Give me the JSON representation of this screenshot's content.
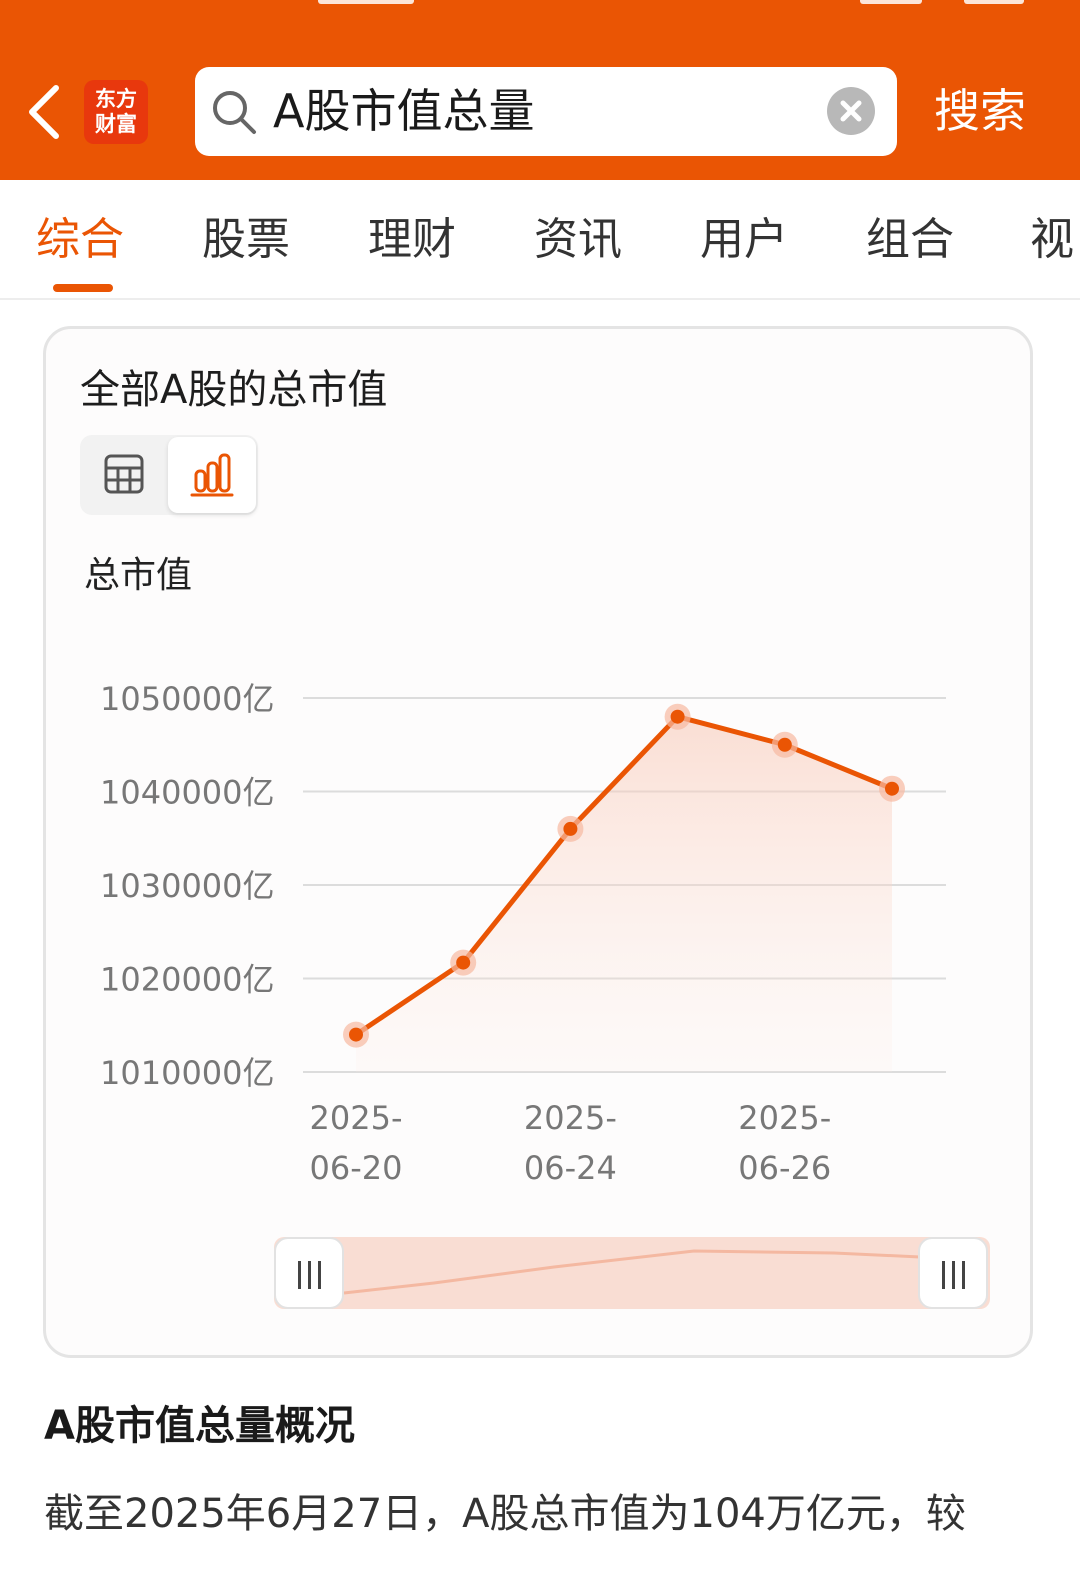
{
  "header": {
    "logo_line1": "东方",
    "logo_line2": "财富",
    "search_query": "A股市值总量",
    "search_button": "搜索",
    "accent_color": "#ea5504"
  },
  "tabs": [
    {
      "label": "综合",
      "active": true
    },
    {
      "label": "股票",
      "active": false
    },
    {
      "label": "理财",
      "active": false
    },
    {
      "label": "资讯",
      "active": false
    },
    {
      "label": "用户",
      "active": false
    },
    {
      "label": "组合",
      "active": false
    },
    {
      "label": "视",
      "active": false
    }
  ],
  "card": {
    "title": "全部A股的总市值",
    "view_toggle": {
      "options": [
        "table-icon",
        "bar-chart-icon"
      ],
      "selected": "bar-chart-icon"
    },
    "metric_label": "总市值"
  },
  "chart_data": {
    "type": "line",
    "x": [
      "2025-06-20",
      "",
      "2025-06-24",
      "",
      "2025-06-26",
      ""
    ],
    "x_tick_labels": [
      {
        "line1": "2025-",
        "line2": "06-20"
      },
      {
        "line1": "2025-",
        "line2": "06-24"
      },
      {
        "line1": "2025-",
        "line2": "06-26"
      }
    ],
    "x_tick_index": [
      0,
      2,
      4
    ],
    "series": [
      {
        "values": [
          1014000,
          1021700,
          1036000,
          1048000,
          1045000,
          1040300
        ]
      }
    ],
    "y_ticks": [
      "1050000亿",
      "1040000亿",
      "1030000亿",
      "1020000亿",
      "1010000亿"
    ],
    "y_tick_values": [
      1050000,
      1040000,
      1030000,
      1020000,
      1010000
    ],
    "ylim": [
      1010000,
      1050000
    ],
    "grid": true,
    "line_color": "#ea5504"
  },
  "summary": {
    "title": "A股市值总量概况",
    "text": "截至2025年6月27日，A股总市值为104万亿元，较"
  }
}
